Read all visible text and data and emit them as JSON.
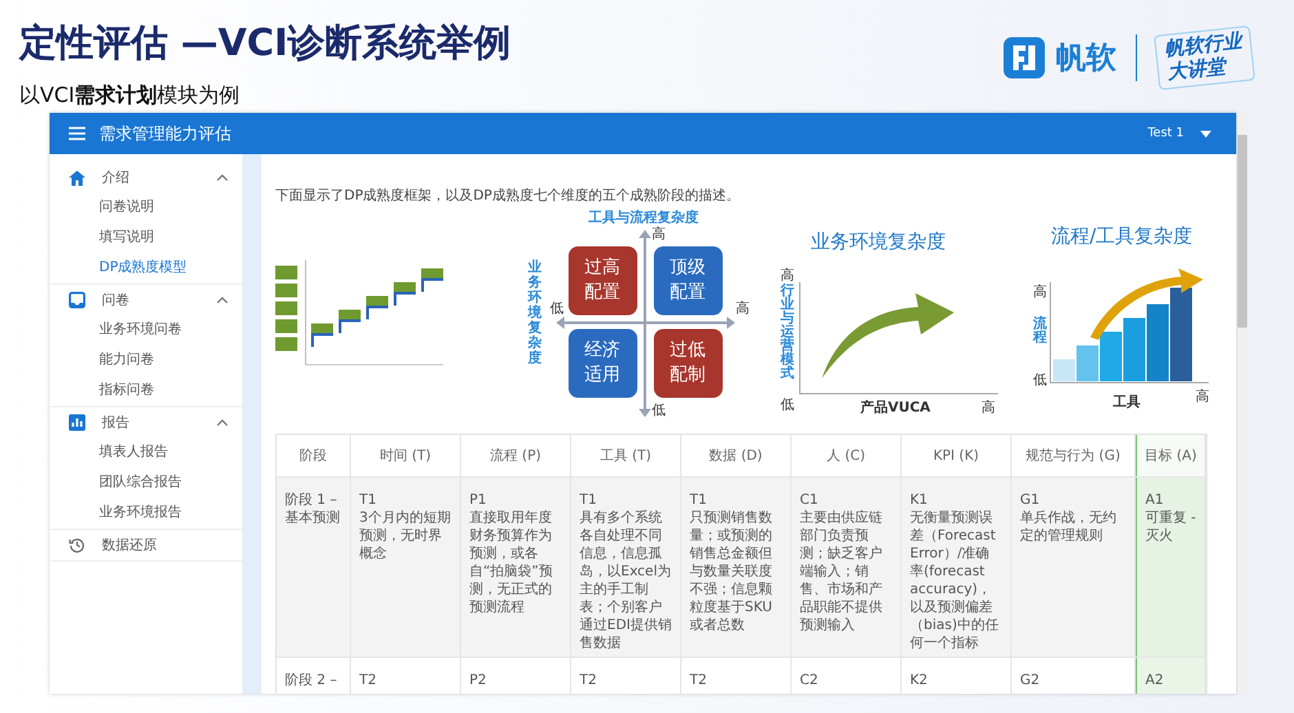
{
  "slide": {
    "title": "定性评估 —VCI诊断系统举例",
    "subtitle": "以VCI**需求计划**模块为例"
  },
  "logo": {
    "brand": "帆软",
    "badge_lines": [
      "帆软行业",
      "大讲堂"
    ]
  },
  "app": {
    "title": "需求管理能力评估",
    "user": "Test 1"
  },
  "sidebar": {
    "sections": [
      {
        "kind": "group",
        "label": "介绍",
        "expanded": true,
        "children": [
          {
            "label": "问卷说明",
            "selected": false
          },
          {
            "label": "填写说明",
            "selected": false
          },
          {
            "label": "DP成熟度模型",
            "selected": true
          }
        ]
      },
      {
        "kind": "group",
        "label": "问卷",
        "expanded": true,
        "children": [
          {
            "label": "业务环境问卷",
            "selected": false
          },
          {
            "label": "能力问卷",
            "selected": false
          },
          {
            "label": "指标问卷",
            "selected": false
          }
        ]
      },
      {
        "kind": "group",
        "label": "报告",
        "expanded": true,
        "children": [
          {
            "label": "填表人报告",
            "selected": false
          },
          {
            "label": "团队综合报告",
            "selected": false
          },
          {
            "label": "业务环境报告",
            "selected": false
          }
        ]
      },
      {
        "kind": "link",
        "label": "数据还原"
      }
    ]
  },
  "intro": "下面显示了DP成熟度框架，以及DP成熟度七个维度的五个成熟阶段的描述。",
  "quadrant": {
    "top_label": "工具与流程复杂度",
    "left_label": "业务环境复杂度",
    "y_high": "高",
    "y_low": "低",
    "x_low": "低",
    "x_high": "高",
    "cells": [
      {
        "label": "过高配置",
        "color": "#a8362c"
      },
      {
        "label": "顶级配置",
        "color": "#2a6bbf"
      },
      {
        "label": "经济适用",
        "color": "#2a6bbf"
      },
      {
        "label": "过低配制",
        "color": "#a8362c"
      }
    ]
  },
  "environment_chart": {
    "title": "业务环境复杂度",
    "y_high": "高",
    "y_label": "行业与运营模式",
    "y_low": "低",
    "x_label": "产品VUCA",
    "x_high": "高"
  },
  "tool_chart": {
    "title": "流程/工具复杂度",
    "y_high": "高",
    "y_label": "流程",
    "y_low": "低",
    "x_label": "工具",
    "x_high": "高"
  },
  "table": {
    "columns": [
      {
        "label": "阶段",
        "highlighted": false
      },
      {
        "label": "时间 (T)",
        "highlighted": false
      },
      {
        "label": "流程 (P)",
        "highlighted": false
      },
      {
        "label": "工具 (T)",
        "highlighted": false
      },
      {
        "label": "数据 (D)",
        "highlighted": false
      },
      {
        "label": "人 (C)",
        "highlighted": false
      },
      {
        "label": "KPI (K)",
        "highlighted": false
      },
      {
        "label": "规范与行为 (G)",
        "highlighted": false
      },
      {
        "label": "目标 (A)",
        "highlighted": true
      }
    ],
    "rows": [
      {
        "cells": [
          {
            "text": "阶段 1 – 基本预测"
          },
          {
            "code": "T1",
            "text": "3个月内的短期预测，无时界概念"
          },
          {
            "code": "P1",
            "text": "直接取用年度财务预算作为预测，或各自“拍脑袋”预测，无正式的预测流程"
          },
          {
            "code": "T1",
            "text": "具有多个系统各自处理不同信息，信息孤岛，以Excel为主的手工制表；个别客户通过EDI提供销售数据"
          },
          {
            "code": "T1",
            "text": "只预测销售数量；或预测的销售总金额但与数量关联度不强；信息颗粒度基于SKU或者总数"
          },
          {
            "code": "C1",
            "text": "主要由供应链部门负责预测；缺乏客户端输入；销售、市场和产品职能不提供预测输入"
          },
          {
            "code": "K1",
            "text": "无衡量预测误差（Forecast Error）/准确率(forecast accuracy)，以及预测偏差（bias)中的任何一个指标"
          },
          {
            "code": "G1",
            "text": "单兵作战，无约定的管理规则"
          },
          {
            "code": "A1",
            "text": "可重复 - 灭火"
          }
        ]
      },
      {
        "cells": [
          {
            "text": "阶段 2 –"
          },
          {
            "code": "T2"
          },
          {
            "code": "P2"
          },
          {
            "code": "T2"
          },
          {
            "code": "T2"
          },
          {
            "code": "C2"
          },
          {
            "code": "K2"
          },
          {
            "code": "G2"
          },
          {
            "code": "A2"
          }
        ]
      }
    ]
  }
}
